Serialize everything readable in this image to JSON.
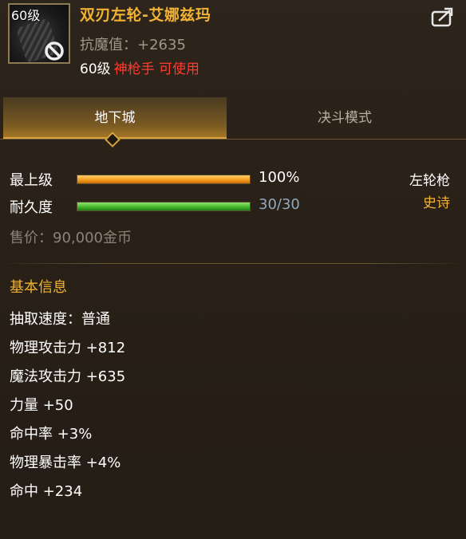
{
  "item": {
    "icon_level": "60级",
    "name": "双刃左轮-艾娜兹玛",
    "resist": "抗魔值：+2635",
    "req_level": "60级",
    "req_class": "神枪手 可使用",
    "icons": [
      "weapon-icon",
      "ban-icon",
      "share-icon"
    ]
  },
  "tabs": [
    {
      "label": "地下城",
      "active": true
    },
    {
      "label": "决斗模式",
      "active": false
    }
  ],
  "stats": {
    "upgrade_label": "最上级",
    "upgrade_value": "100%",
    "upgrade_fraction": 1.0,
    "durability_label": "耐久度",
    "durability_value": "30/30",
    "durability_fraction": 1.0,
    "weapon_type": "左轮枪",
    "rarity": "史诗",
    "price": "售价：90,000金币"
  },
  "basic": {
    "title": "基本信息",
    "attributes": [
      "抽取速度：普通",
      "物理攻击力 +812",
      "魔法攻击力 +635",
      "力量 +50",
      "命中率 +3%",
      "物理暴击率 +4%",
      "命中 +234"
    ]
  },
  "colors": {
    "gold": "#f2b233",
    "red": "#ff3b30",
    "durability_text": "#8fa8c0"
  }
}
